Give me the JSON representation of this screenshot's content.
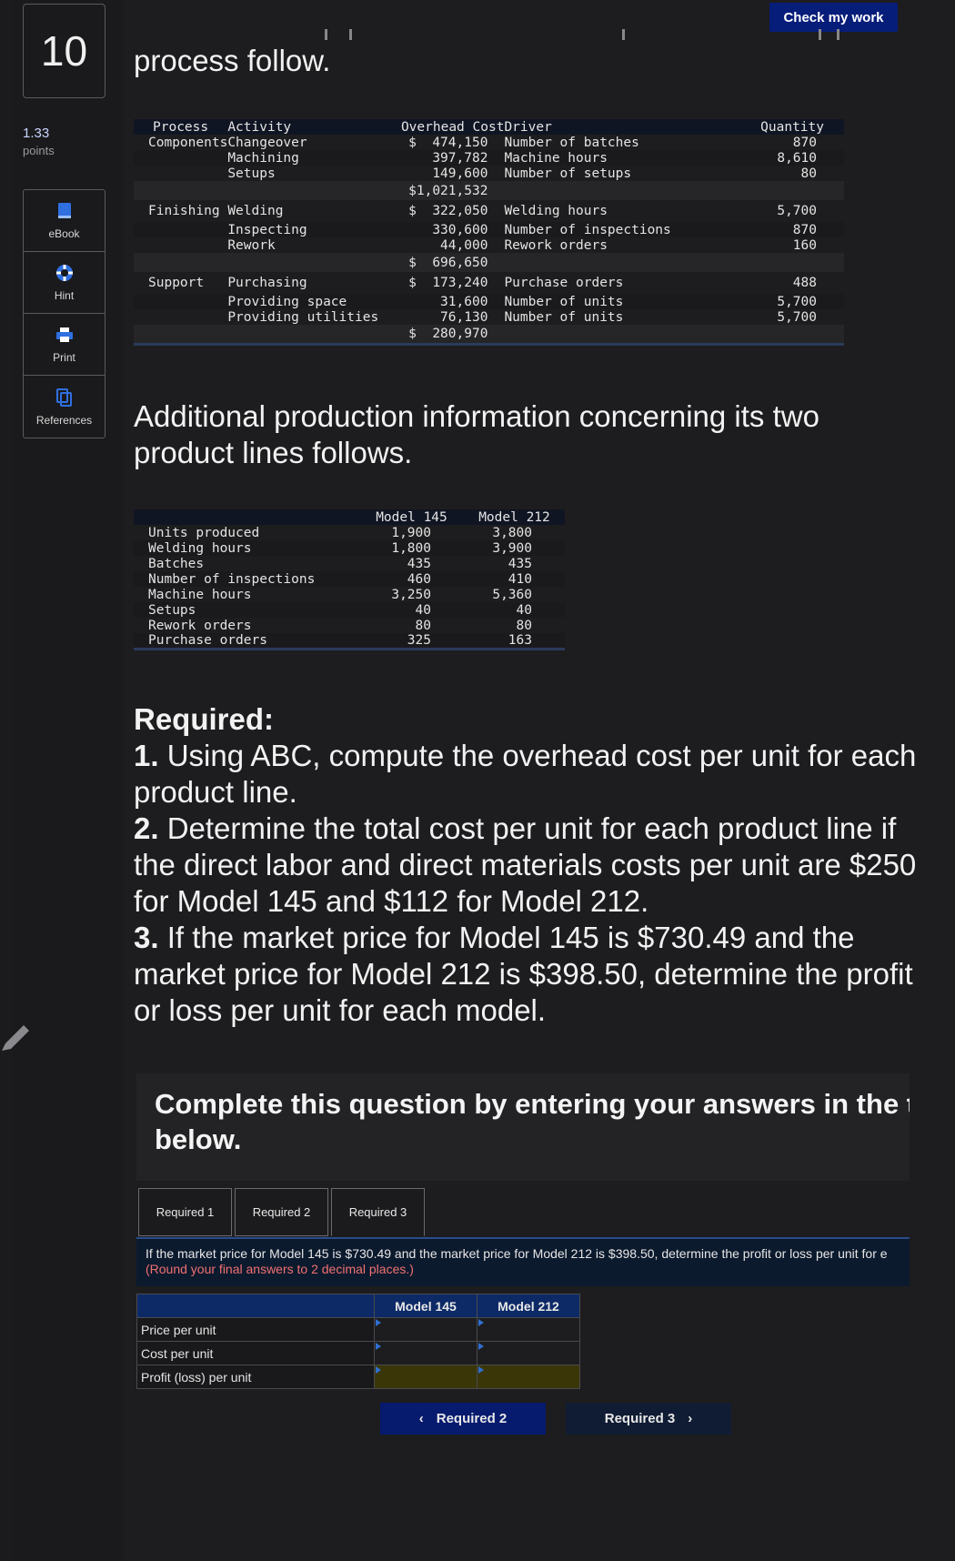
{
  "question": {
    "number": "10",
    "points_value": "1.33",
    "points_label": "points"
  },
  "tools": [
    {
      "label": "eBook",
      "icon": "book-icon"
    },
    {
      "label": "Hint",
      "icon": "lifebuoy-icon"
    },
    {
      "label": "Print",
      "icon": "printer-icon"
    },
    {
      "label": "References",
      "icon": "copy-icon"
    }
  ],
  "header": {
    "check_label": "Check my work"
  },
  "intro_text": "process follow.",
  "overhead_table": {
    "headers": [
      "Process",
      "Activity",
      "Overhead Cost",
      "Driver",
      "Quantity"
    ],
    "rows": [
      [
        "Components",
        "Changeover",
        "$  474,150",
        "Number of batches",
        "870"
      ],
      [
        "",
        "Machining",
        "397,782",
        "Machine hours",
        "8,610"
      ],
      [
        "",
        "Setups",
        "149,600",
        "Number of setups",
        "80"
      ],
      [
        "",
        "",
        "$1,021,532",
        "",
        ""
      ],
      [
        "Finishing",
        "Welding",
        "$  322,050",
        "Welding hours",
        "5,700"
      ],
      [
        "",
        "Inspecting",
        "330,600",
        "Number of inspections",
        "870"
      ],
      [
        "",
        "Rework",
        "44,000",
        "Rework orders",
        "160"
      ],
      [
        "",
        "",
        "$  696,650",
        "",
        ""
      ],
      [
        "Support",
        "Purchasing",
        "$  173,240",
        "Purchase orders",
        "488"
      ],
      [
        "",
        "Providing space",
        "31,600",
        "Number of units",
        "5,700"
      ],
      [
        "",
        "Providing utilities",
        "76,130",
        "Number of units",
        "5,700"
      ],
      [
        "",
        "",
        "$  280,970",
        "",
        ""
      ]
    ]
  },
  "additional_text": "Additional production information concerning its two product lines follows.",
  "production_table": {
    "headers": [
      "",
      "Model 145",
      "Model 212"
    ],
    "rows": [
      [
        "Units produced",
        "1,900",
        "3,800"
      ],
      [
        "Welding hours",
        "1,800",
        "3,900"
      ],
      [
        "Batches",
        "435",
        "435"
      ],
      [
        "Number of inspections",
        "460",
        "410"
      ],
      [
        "Machine hours",
        "3,250",
        "5,360"
      ],
      [
        "Setups",
        "40",
        "40"
      ],
      [
        "Rework orders",
        "80",
        "80"
      ],
      [
        "Purchase orders",
        "325",
        "163"
      ]
    ]
  },
  "required": {
    "title": "Required:",
    "items": [
      {
        "num": "1.",
        "text": "Using ABC, compute the overhead cost per unit for each product line."
      },
      {
        "num": "2.",
        "text": "Determine the total cost per unit for each product line if the direct labor and direct materials costs per unit are $250 for Model 145 and $112 for Model 212."
      },
      {
        "num": "3.",
        "text": "If the market price for Model 145 is $730.49 and the market price for Model 212 is $398.50, determine the profit or loss per unit for each model."
      }
    ]
  },
  "complete_text": "Complete this question by entering your answers in the t below.",
  "tabs": [
    "Required 1",
    "Required 2",
    "Required 3"
  ],
  "instruction": {
    "main": "If the market price for Model 145 is $730.49 and the market price for Model 212 is $398.50, determine the profit or loss per unit for e",
    "note": "(Round your final answers to 2 decimal places.)"
  },
  "answer_table": {
    "headers": [
      "Model 145",
      "Model 212"
    ],
    "rows": [
      "Price per unit",
      "Cost per unit",
      "Profit (loss) per unit"
    ]
  },
  "nav": {
    "prev": "Required 2",
    "next": "Required 3"
  }
}
